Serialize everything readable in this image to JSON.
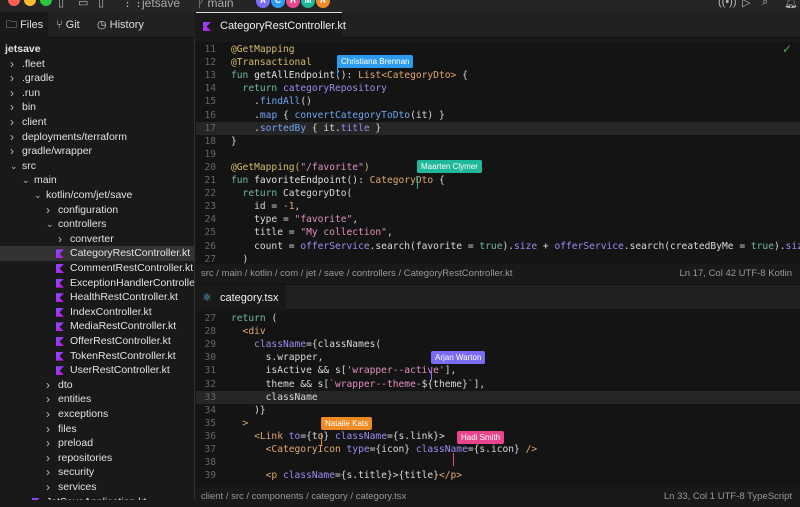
{
  "titlebar": {
    "project": "jetsave",
    "branch": "main",
    "avatars": [
      {
        "letter": "A",
        "color": "#7b6cf6"
      },
      {
        "letter": "C",
        "color": "#2d9cf0"
      },
      {
        "letter": "H",
        "color": "#e8468c"
      },
      {
        "letter": "M",
        "color": "#1fb89a"
      },
      {
        "letter": "N",
        "color": "#f08a24"
      }
    ]
  },
  "panel_tabs": [
    {
      "label": "Files"
    },
    {
      "label": "Git"
    },
    {
      "label": "History"
    }
  ],
  "tree": [
    {
      "label": "jetsave",
      "level": 0,
      "type": "root"
    },
    {
      "label": ".fleet",
      "level": 0,
      "type": "folder"
    },
    {
      "label": ".gradle",
      "level": 0,
      "type": "folder"
    },
    {
      "label": ".run",
      "level": 0,
      "type": "folder"
    },
    {
      "label": "bin",
      "level": 0,
      "type": "folder"
    },
    {
      "label": "client",
      "level": 0,
      "type": "folder"
    },
    {
      "label": "deployments/terraform",
      "level": 0,
      "type": "folder"
    },
    {
      "label": "gradle/wrapper",
      "level": 0,
      "type": "folder"
    },
    {
      "label": "src",
      "level": 0,
      "type": "open"
    },
    {
      "label": "main",
      "level": 1,
      "type": "open"
    },
    {
      "label": "kotlin/com/jet/save",
      "level": 2,
      "type": "open"
    },
    {
      "label": "configuration",
      "level": 3,
      "type": "folder"
    },
    {
      "label": "controllers",
      "level": 3,
      "type": "open"
    },
    {
      "label": "converter",
      "level": 4,
      "type": "folder"
    },
    {
      "label": "CategoryRestController.kt",
      "level": 4,
      "type": "kt",
      "selected": true
    },
    {
      "label": "CommentRestController.kt",
      "level": 4,
      "type": "kt"
    },
    {
      "label": "ExceptionHandlerController",
      "level": 4,
      "type": "kt"
    },
    {
      "label": "HealthRestController.kt",
      "level": 4,
      "type": "kt"
    },
    {
      "label": "IndexController.kt",
      "level": 4,
      "type": "kt"
    },
    {
      "label": "MediaRestController.kt",
      "level": 4,
      "type": "kt"
    },
    {
      "label": "OfferRestController.kt",
      "level": 4,
      "type": "kt"
    },
    {
      "label": "TokenRestController.kt",
      "level": 4,
      "type": "kt"
    },
    {
      "label": "UserRestController.kt",
      "level": 4,
      "type": "kt"
    },
    {
      "label": "dto",
      "level": 3,
      "type": "folder"
    },
    {
      "label": "entities",
      "level": 3,
      "type": "folder"
    },
    {
      "label": "exceptions",
      "level": 3,
      "type": "folder"
    },
    {
      "label": "files",
      "level": 3,
      "type": "folder"
    },
    {
      "label": "preload",
      "level": 3,
      "type": "folder"
    },
    {
      "label": "repositories",
      "level": 3,
      "type": "folder"
    },
    {
      "label": "security",
      "level": 3,
      "type": "folder"
    },
    {
      "label": "services",
      "level": 3,
      "type": "folder"
    },
    {
      "label": "JetSaveApplication.kt",
      "level": 2,
      "type": "kt"
    }
  ],
  "editor1": {
    "tab": "CategoryRestController.kt",
    "current_line": 17,
    "lines": [
      {
        "n": "11",
        "t": [
          [
            "@GetMapping",
            "an"
          ]
        ]
      },
      {
        "n": "12",
        "t": [
          [
            "@Transactional",
            "an"
          ]
        ]
      },
      {
        "n": "13",
        "t": [
          [
            "fun ",
            "kw"
          ],
          [
            "getAllEndpoint",
            "fn"
          ],
          [
            "(): ",
            "pl"
          ],
          [
            "List<CategoryDto>",
            "ty"
          ],
          [
            " {",
            "pl"
          ]
        ]
      },
      {
        "n": "14",
        "t": [
          [
            "  return ",
            "kw"
          ],
          [
            "categoryRepository",
            "pr"
          ]
        ]
      },
      {
        "n": "15",
        "t": [
          [
            "    .",
            "pl"
          ],
          [
            "findAll",
            "me"
          ],
          [
            "()",
            "pl"
          ]
        ]
      },
      {
        "n": "16",
        "t": [
          [
            "    .",
            "pl"
          ],
          [
            "map",
            "me"
          ],
          [
            " { ",
            "pl"
          ],
          [
            "convertCategoryToDto",
            "me"
          ],
          [
            "(it) }",
            "pl"
          ]
        ]
      },
      {
        "n": "17",
        "t": [
          [
            "    .",
            "pl"
          ],
          [
            "sortedBy",
            "me"
          ],
          [
            " { it.",
            "pl"
          ],
          [
            "title",
            "pr"
          ],
          [
            " }",
            "pl"
          ]
        ]
      },
      {
        "n": "18",
        "t": [
          [
            "}",
            "pl"
          ]
        ]
      },
      {
        "n": "19",
        "t": []
      },
      {
        "n": "20",
        "t": [
          [
            "@GetMapping(",
            "an"
          ],
          [
            "\"/favorite\"",
            "st"
          ],
          [
            ")",
            "an"
          ]
        ]
      },
      {
        "n": "21",
        "t": [
          [
            "fun ",
            "kw"
          ],
          [
            "favoriteEndpoint",
            "fn"
          ],
          [
            "(): ",
            "pl"
          ],
          [
            "CategoryDto",
            "ty"
          ],
          [
            " {",
            "pl"
          ]
        ]
      },
      {
        "n": "22",
        "t": [
          [
            "  return ",
            "kw"
          ],
          [
            "CategoryDto(",
            "pl"
          ]
        ]
      },
      {
        "n": "23",
        "t": [
          [
            "    id = ",
            "pl"
          ],
          [
            "-1",
            "ty"
          ],
          [
            ",",
            "pl"
          ]
        ]
      },
      {
        "n": "24",
        "t": [
          [
            "    type = ",
            "pl"
          ],
          [
            "\"favorite\"",
            "st"
          ],
          [
            ",",
            "pl"
          ]
        ]
      },
      {
        "n": "25",
        "t": [
          [
            "    title = ",
            "pl"
          ],
          [
            "\"My collection\"",
            "st"
          ],
          [
            ",",
            "pl"
          ]
        ]
      },
      {
        "n": "26",
        "t": [
          [
            "    count = ",
            "pl"
          ],
          [
            "offerService",
            "pr"
          ],
          [
            ".search(favorite = ",
            "pl"
          ],
          [
            "true",
            "kw"
          ],
          [
            ").",
            "pl"
          ],
          [
            "size",
            "pr"
          ],
          [
            " + ",
            "pl"
          ],
          [
            "offerService",
            "pr"
          ],
          [
            ".search(createdByMe = ",
            "pl"
          ],
          [
            "true",
            "kw"
          ],
          [
            ").",
            "pl"
          ],
          [
            "size",
            "pr"
          ],
          [
            ",",
            "pl"
          ]
        ]
      },
      {
        "n": "27",
        "t": [
          [
            "  )",
            "pl"
          ]
        ]
      }
    ],
    "breadcrumb": "src  /  main  /  kotlin  /  com  /  jet  /  save  /  controllers  /  CategoryRestController.kt",
    "status": "Ln 17, Col 42    UTF-8    Kotlin"
  },
  "editor2": {
    "tab": "category.tsx",
    "current_line": 33,
    "lines": [
      {
        "n": "27",
        "t": [
          [
            "return ",
            "kw"
          ],
          [
            "(",
            "pl"
          ]
        ]
      },
      {
        "n": "28",
        "t": [
          [
            "  <div",
            "tag"
          ]
        ]
      },
      {
        "n": "29",
        "t": [
          [
            "    className",
            "at"
          ],
          [
            "={classNames(",
            "pl"
          ]
        ]
      },
      {
        "n": "30",
        "t": [
          [
            "      s.wrapper,",
            "pl"
          ]
        ]
      },
      {
        "n": "31",
        "t": [
          [
            "      isActive && s[",
            "pl"
          ],
          [
            "'wrapper--active'",
            "st"
          ],
          [
            "],",
            "pl"
          ]
        ]
      },
      {
        "n": "32",
        "t": [
          [
            "      theme && s[",
            "pl"
          ],
          [
            "`wrapper--theme-",
            "st"
          ],
          [
            "${theme}",
            "pl"
          ],
          [
            "`",
            "st"
          ],
          [
            "],",
            "pl"
          ]
        ]
      },
      {
        "n": "33",
        "t": [
          [
            "      className",
            "pl"
          ]
        ]
      },
      {
        "n": "34",
        "t": [
          [
            "    )}",
            "pl"
          ]
        ]
      },
      {
        "n": "35",
        "t": [
          [
            "  >",
            "tag"
          ]
        ]
      },
      {
        "n": "36",
        "t": [
          [
            "    <Link ",
            "tag"
          ],
          [
            "to",
            "at"
          ],
          [
            "={to} ",
            "pl"
          ],
          [
            "className",
            "at"
          ],
          [
            "={s.link}>",
            "pl"
          ]
        ]
      },
      {
        "n": "37",
        "t": [
          [
            "      <CategoryIcon ",
            "tag"
          ],
          [
            "type",
            "at"
          ],
          [
            "={icon} ",
            "pl"
          ],
          [
            "className",
            "at"
          ],
          [
            "={s.icon} ",
            "pl"
          ],
          [
            "/>",
            "tag"
          ]
        ]
      },
      {
        "n": "38",
        "t": []
      },
      {
        "n": "39",
        "t": [
          [
            "      <p ",
            "tag"
          ],
          [
            "className",
            "at"
          ],
          [
            "={s.title}>{title}",
            "pl"
          ],
          [
            "</p>",
            "tag"
          ]
        ]
      }
    ],
    "breadcrumb": "client  /  src  /  components  /  category  /  category.tsx",
    "status": "Ln 33, Col 1    UTF-8    TypeScript"
  },
  "collaborators": [
    {
      "name": "Christiana Brennan",
      "color": "#2d9cf0"
    },
    {
      "name": "Maarten Clymer",
      "color": "#1fb89a"
    },
    {
      "name": "Arjan Warton",
      "color": "#7b6cf6"
    },
    {
      "name": "Natalie Kats",
      "color": "#f08a24"
    },
    {
      "name": "Hadi Smith",
      "color": "#e8468c"
    }
  ]
}
